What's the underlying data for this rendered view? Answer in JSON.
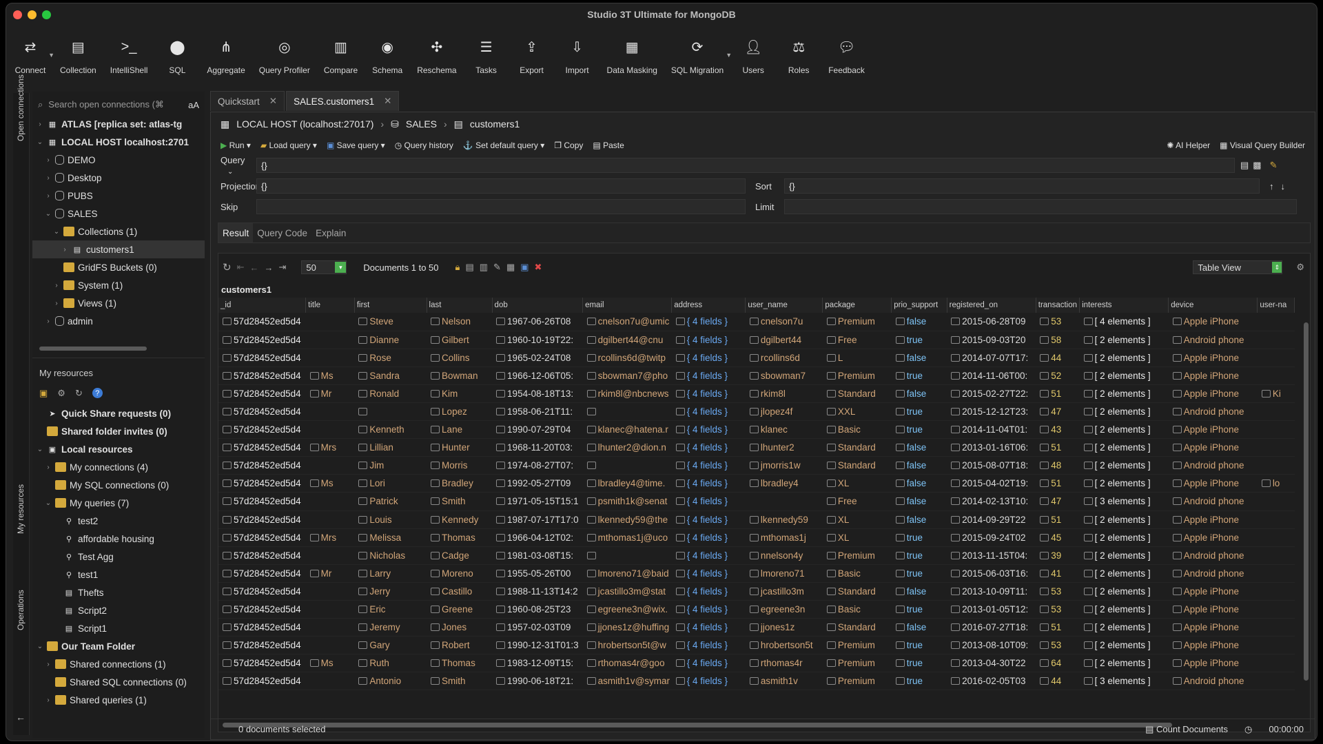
{
  "window": {
    "title": "Studio 3T Ultimate for MongoDB"
  },
  "toolbar": [
    {
      "label": "Connect",
      "icon": "connect-icon",
      "caret": true
    },
    {
      "label": "Collection",
      "icon": "collection-icon"
    },
    {
      "label": "IntelliShell",
      "icon": "intellishell-icon"
    },
    {
      "label": "SQL",
      "icon": "sql-icon"
    },
    {
      "label": "Aggregate",
      "icon": "aggregate-icon"
    },
    {
      "label": "Query Profiler",
      "icon": "query-profiler-icon"
    },
    {
      "label": "Compare",
      "icon": "compare-icon"
    },
    {
      "label": "Schema",
      "icon": "schema-icon"
    },
    {
      "label": "Reschema",
      "icon": "reschema-icon"
    },
    {
      "label": "Tasks",
      "icon": "tasks-icon"
    },
    {
      "label": "Export",
      "icon": "export-icon"
    },
    {
      "label": "Import",
      "icon": "import-icon"
    },
    {
      "label": "Data Masking",
      "icon": "data-masking-icon"
    },
    {
      "label": "SQL Migration",
      "icon": "sql-migration-icon",
      "caret": true
    },
    {
      "label": "Users",
      "icon": "users-icon"
    },
    {
      "label": "Roles",
      "icon": "roles-icon"
    },
    {
      "label": "Feedback",
      "icon": "feedback-icon"
    }
  ],
  "sidestrip": {
    "open_connections": "Open connections",
    "my_resources": "My resources",
    "operations": "Operations"
  },
  "sidebar": {
    "search_placeholder": "Search open connections (⌘",
    "case_toggle": "aA",
    "tree": [
      {
        "label": "ATLAS [replica set: atlas-tg",
        "level": 0,
        "twisty": "›",
        "bold": true,
        "icon": "server"
      },
      {
        "label": "LOCAL HOST localhost:2701",
        "level": 0,
        "twisty": "⌄",
        "bold": true,
        "icon": "server"
      },
      {
        "label": "DEMO",
        "level": 1,
        "twisty": "›",
        "icon": "db"
      },
      {
        "label": "Desktop",
        "level": 1,
        "twisty": "›",
        "icon": "db"
      },
      {
        "label": "PUBS",
        "level": 1,
        "twisty": "›",
        "icon": "db"
      },
      {
        "label": "SALES",
        "level": 1,
        "twisty": "⌄",
        "icon": "db"
      },
      {
        "label": "Collections (1)",
        "level": 2,
        "twisty": "⌄",
        "icon": "folder"
      },
      {
        "label": "customers1",
        "level": 3,
        "twisty": "›",
        "icon": "collection",
        "selected": true
      },
      {
        "label": "GridFS Buckets (0)",
        "level": 2,
        "twisty": "",
        "icon": "folder"
      },
      {
        "label": "System (1)",
        "level": 2,
        "twisty": "›",
        "icon": "folder"
      },
      {
        "label": "Views (1)",
        "level": 2,
        "twisty": "›",
        "icon": "folder"
      },
      {
        "label": "admin",
        "level": 1,
        "twisty": "›",
        "icon": "db"
      }
    ],
    "resources_title": "My resources",
    "resources": [
      {
        "label": "Quick Share requests (0)",
        "level": 0,
        "twisty": "",
        "bold": true,
        "icon": "share"
      },
      {
        "label": "Shared folder invites (0)",
        "level": 0,
        "twisty": "",
        "bold": true,
        "icon": "folder"
      },
      {
        "label": "Local resources",
        "level": 0,
        "twisty": "⌄",
        "bold": true,
        "icon": "local"
      },
      {
        "label": "My connections (4)",
        "level": 1,
        "twisty": "›",
        "icon": "folder"
      },
      {
        "label": "My SQL connections (0)",
        "level": 1,
        "twisty": "",
        "icon": "folder"
      },
      {
        "label": "My queries (7)",
        "level": 1,
        "twisty": "⌄",
        "icon": "folder"
      },
      {
        "label": "test2",
        "level": 2,
        "twisty": "",
        "icon": "query"
      },
      {
        "label": "affordable housing",
        "level": 2,
        "twisty": "",
        "icon": "query"
      },
      {
        "label": "Test Agg",
        "level": 2,
        "twisty": "",
        "icon": "query"
      },
      {
        "label": "test1",
        "level": 2,
        "twisty": "",
        "icon": "query"
      },
      {
        "label": "Thefts",
        "level": 2,
        "twisty": "",
        "icon": "script"
      },
      {
        "label": "Script2",
        "level": 2,
        "twisty": "",
        "icon": "script"
      },
      {
        "label": "Script1",
        "level": 2,
        "twisty": "",
        "icon": "script"
      },
      {
        "label": "Our Team Folder",
        "level": 0,
        "twisty": "⌄",
        "bold": true,
        "icon": "folder"
      },
      {
        "label": "Shared connections (1)",
        "level": 1,
        "twisty": "›",
        "icon": "folder"
      },
      {
        "label": "Shared SQL connections (0)",
        "level": 1,
        "twisty": "",
        "icon": "folder"
      },
      {
        "label": "Shared queries (1)",
        "level": 1,
        "twisty": "›",
        "icon": "folder"
      }
    ]
  },
  "tabs": [
    {
      "label": "Quickstart",
      "active": false
    },
    {
      "label": "SALES.customers1",
      "active": true
    }
  ],
  "breadcrumb": {
    "host": "LOCAL HOST (localhost:27017)",
    "db": "SALES",
    "collection": "customers1"
  },
  "querybar": {
    "run": "Run",
    "load": "Load query",
    "save": "Save query",
    "history": "Query history",
    "default": "Set default query",
    "copy": "Copy",
    "paste": "Paste",
    "ai": "AI Helper",
    "vqb": "Visual Query Builder"
  },
  "fields": {
    "query_label": "Query",
    "query_value": "{}",
    "projection_label": "Projection",
    "projection_value": "{}",
    "sort_label": "Sort",
    "sort_value": "{}",
    "skip_label": "Skip",
    "skip_value": "",
    "limit_label": "Limit",
    "limit_value": ""
  },
  "result_tabs": [
    {
      "label": "Result",
      "active": true
    },
    {
      "label": "Query Code"
    },
    {
      "label": "Explain"
    }
  ],
  "grid": {
    "page_size": "50",
    "range": "Documents 1 to 50",
    "view": "Table View",
    "collection": "customers1",
    "columns": [
      "_id",
      "title",
      "first",
      "last",
      "dob",
      "email",
      "address",
      "user_name",
      "package",
      "prio_support",
      "registered_on",
      "transaction",
      "interests",
      "device",
      "user-na"
    ],
    "rows": [
      [
        "57d28452ed5d4",
        "",
        "Steve",
        "Nelson",
        "1967-06-26T08",
        "cnelson7u@umic",
        "{ 4 fields }",
        "cnelson7u",
        "Premium",
        "false",
        "2015-06-28T09",
        "53",
        "[ 4 elements ]",
        "Apple iPhone",
        ""
      ],
      [
        "57d28452ed5d4",
        "",
        "Dianne",
        "Gilbert",
        "1960-10-19T22:",
        "dgilbert44@cnu",
        "{ 4 fields }",
        "dgilbert44",
        "Free",
        "true",
        "2015-09-03T20",
        "58",
        "[ 2 elements ]",
        "Android phone",
        ""
      ],
      [
        "57d28452ed5d4",
        "",
        "Rose",
        "Collins",
        "1965-02-24T08",
        "rcollins6d@twitp",
        "{ 4 fields }",
        "rcollins6d",
        "L",
        "false",
        "2014-07-07T17:",
        "44",
        "[ 2 elements ]",
        "Apple iPhone",
        ""
      ],
      [
        "57d28452ed5d4",
        "Ms",
        "Sandra",
        "Bowman",
        "1966-12-06T05:",
        "sbowman7@pho",
        "{ 4 fields }",
        "sbowman7",
        "Premium",
        "true",
        "2014-11-06T00:",
        "52",
        "[ 2 elements ]",
        "Apple iPhone",
        ""
      ],
      [
        "57d28452ed5d4",
        "Mr",
        "Ronald",
        "Kim",
        "1954-08-18T13:",
        "rkim8l@nbcnews",
        "{ 4 fields }",
        "rkim8l",
        "Standard",
        "false",
        "2015-02-27T22:",
        "51",
        "[ 2 elements ]",
        "Apple iPhone",
        "Ki"
      ],
      [
        "57d28452ed5d4",
        "",
        "",
        "Lopez",
        "1958-06-21T11:",
        "",
        "{ 4 fields }",
        "jlopez4f",
        "XXL",
        "true",
        "2015-12-12T23:",
        "47",
        "[ 2 elements ]",
        "Android phone",
        ""
      ],
      [
        "57d28452ed5d4",
        "",
        "Kenneth",
        "Lane",
        "1990-07-29T04",
        "klanec@hatena.r",
        "{ 4 fields }",
        "klanec",
        "Basic",
        "true",
        "2014-11-04T01:",
        "43",
        "[ 2 elements ]",
        "Apple iPhone",
        ""
      ],
      [
        "57d28452ed5d4",
        "Mrs",
        "Lillian",
        "Hunter",
        "1968-11-20T03:",
        "lhunter2@dion.n",
        "{ 4 fields }",
        "lhunter2",
        "Standard",
        "false",
        "2013-01-16T06:",
        "51",
        "[ 2 elements ]",
        "Apple iPhone",
        ""
      ],
      [
        "57d28452ed5d4",
        "",
        "Jim",
        "Morris",
        "1974-08-27T07:",
        "",
        "{ 4 fields }",
        "jmorris1w",
        "Standard",
        "false",
        "2015-08-07T18:",
        "48",
        "[ 2 elements ]",
        "Android phone",
        ""
      ],
      [
        "57d28452ed5d4",
        "Ms",
        "Lori",
        "Bradley",
        "1992-05-27T09",
        "lbradley4@time.",
        "{ 4 fields }",
        "lbradley4",
        "XL",
        "false",
        "2015-04-02T19:",
        "51",
        "[ 2 elements ]",
        "Apple iPhone",
        "lo"
      ],
      [
        "57d28452ed5d4",
        "",
        "Patrick",
        "Smith",
        "1971-05-15T15:1",
        "psmith1k@senat",
        "{ 4 fields }",
        "",
        "Free",
        "false",
        "2014-02-13T10:",
        "47",
        "[ 3 elements ]",
        "Android phone",
        ""
      ],
      [
        "57d28452ed5d4",
        "",
        "Louis",
        "Kennedy",
        "1987-07-17T17:0",
        "lkennedy59@the",
        "{ 4 fields }",
        "lkennedy59",
        "XL",
        "false",
        "2014-09-29T22",
        "51",
        "[ 2 elements ]",
        "Apple iPhone",
        ""
      ],
      [
        "57d28452ed5d4",
        "Mrs",
        "Melissa",
        "Thomas",
        "1966-04-12T02:",
        "mthomas1j@uco",
        "{ 4 fields }",
        "mthomas1j",
        "XL",
        "true",
        "2015-09-24T02",
        "45",
        "[ 2 elements ]",
        "Apple iPhone",
        ""
      ],
      [
        "57d28452ed5d4",
        "",
        "Nicholas",
        "Cadge",
        "1981-03-08T15:",
        "",
        "{ 4 fields }",
        "nnelson4y",
        "Premium",
        "true",
        "2013-11-15T04:",
        "39",
        "[ 2 elements ]",
        "Android phone",
        ""
      ],
      [
        "57d28452ed5d4",
        "Mr",
        "Larry",
        "Moreno",
        "1955-05-26T00",
        "lmoreno71@baid",
        "{ 4 fields }",
        "lmoreno71",
        "Basic",
        "true",
        "2015-06-03T16:",
        "41",
        "[ 2 elements ]",
        "Android phone",
        ""
      ],
      [
        "57d28452ed5d4",
        "",
        "Jerry",
        "Castillo",
        "1988-11-13T14:2",
        "jcastillo3m@stat",
        "{ 4 fields }",
        "jcastillo3m",
        "Standard",
        "false",
        "2013-10-09T11:",
        "53",
        "[ 2 elements ]",
        "Apple iPhone",
        ""
      ],
      [
        "57d28452ed5d4",
        "",
        "Eric",
        "Greene",
        "1960-08-25T23",
        "egreene3n@wix.",
        "{ 4 fields }",
        "egreene3n",
        "Basic",
        "true",
        "2013-01-05T12:",
        "53",
        "[ 2 elements ]",
        "Apple iPhone",
        ""
      ],
      [
        "57d28452ed5d4",
        "",
        "Jeremy",
        "Jones",
        "1957-02-03T09",
        "jjones1z@huffing",
        "{ 4 fields }",
        "jjones1z",
        "Standard",
        "false",
        "2016-07-27T18:",
        "51",
        "[ 2 elements ]",
        "Apple iPhone",
        ""
      ],
      [
        "57d28452ed5d4",
        "",
        "Gary",
        "Robert",
        "1990-12-31T01:3",
        "hrobertson5t@w",
        "{ 4 fields }",
        "hrobertson5t",
        "Premium",
        "true",
        "2013-08-10T09:",
        "53",
        "[ 2 elements ]",
        "Apple iPhone",
        ""
      ],
      [
        "57d28452ed5d4",
        "Ms",
        "Ruth",
        "Thomas",
        "1983-12-09T15:",
        "rthomas4r@goo",
        "{ 4 fields }",
        "rthomas4r",
        "Premium",
        "true",
        "2013-04-30T22",
        "64",
        "[ 2 elements ]",
        "Apple iPhone",
        ""
      ],
      [
        "57d28452ed5d4",
        "",
        "Antonio",
        "Smith",
        "1990-06-18T21:",
        "asmith1v@symar",
        "{ 4 fields }",
        "asmith1v",
        "Premium",
        "true",
        "2016-02-05T03",
        "44",
        "[ 3 elements ]",
        "Android phone",
        ""
      ]
    ]
  },
  "footer": {
    "selected": "0 documents selected",
    "count": "Count Documents",
    "timer": "00:00:00"
  },
  "colors": {
    "accent": "#6aa9f2",
    "string": "#d2a679",
    "bool": "#7ec3f5",
    "number": "#e1c86a",
    "close": "#ff5f57",
    "minimize": "#febc2e",
    "zoom": "#28c840"
  }
}
